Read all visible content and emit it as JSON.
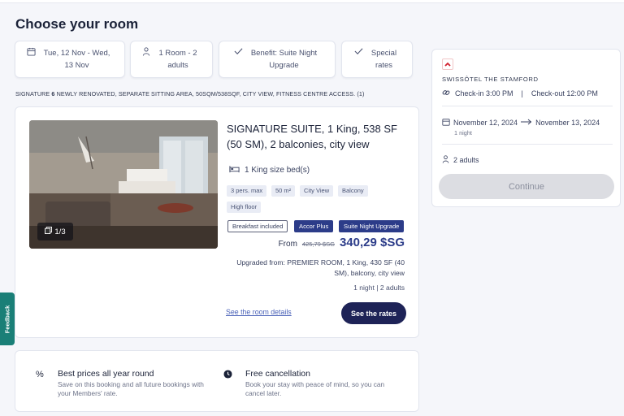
{
  "page": {
    "title": "Choose your room"
  },
  "chips": {
    "dates": "Tue, 12 Nov - Wed, 13 Nov",
    "room": "1 Room - 2 adults",
    "benefit": "Benefit: Suite Night Upgrade",
    "special": "Special rates"
  },
  "description": {
    "prefix": "SIGNATURE",
    "count": "6",
    "text": "NEWLY RENOVATED, SEPARATE SITTING AREA, 50SQM/538SQF, CITY VIEW, FITNESS CENTRE ACCESS. (1)"
  },
  "room": {
    "photo_counter": "1/3",
    "title": "SIGNATURE SUITE, 1 King, 538 SF (50 SM), 2 balconies, city view",
    "bed": "1 King size bed(s)",
    "tags": [
      "3 pers. max",
      "50 m²",
      "City View",
      "Balcony",
      "High floor"
    ],
    "offers": {
      "breakfast": "Breakfast included",
      "accor": "Accor Plus",
      "suite_upgrade": "Suite Night Upgrade"
    },
    "price": {
      "from_label": "From",
      "old": "425,79 $SG",
      "new": "340,29 $SG"
    },
    "upgrade_text": "Upgraded from: PREMIER ROOM, 1 King, 430 SF (40 SM), balcony, city view",
    "occupancy": "1 night | 2 adults",
    "details_link": "See the room details",
    "rates_button": "See the rates"
  },
  "benefits": [
    {
      "icon": "percent-icon",
      "title": "Best prices all year round",
      "text": "Save on this booking and all future bookings with your Members' rate."
    },
    {
      "icon": "clock-icon",
      "title": "Free cancellation",
      "text": "Book your stay with peace of mind, so you can cancel later."
    }
  ],
  "summary": {
    "hotel_name": "SWISSÔTEL THE STAMFORD",
    "check_in": "Check-in 3:00 PM",
    "separator": "|",
    "check_out": "Check-out 12:00 PM",
    "date_from": "November 12, 2024",
    "date_to": "November 13, 2024",
    "nights": "1 night",
    "guests": "2 adults",
    "continue_button": "Continue"
  },
  "feedback": {
    "label": "Feedback"
  },
  "colors": {
    "brand_navy": "#1e2357",
    "price_blue": "#2c3c89",
    "feedback_teal": "#1a7f77",
    "logo_red": "#d0202e"
  }
}
